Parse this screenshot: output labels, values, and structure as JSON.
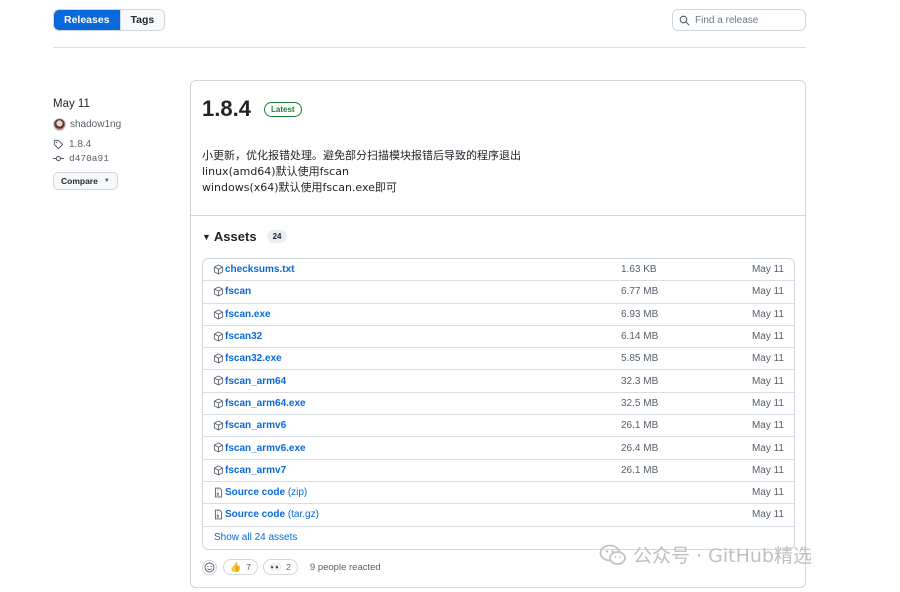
{
  "tabs": {
    "releases": "Releases",
    "tags": "Tags"
  },
  "search": {
    "placeholder": "Find a release"
  },
  "meta": {
    "date": "May 11",
    "author": "shadow1ng",
    "tag": "1.8.4",
    "commit": "d470a91",
    "compare_label": "Compare"
  },
  "release": {
    "version": "1.8.4",
    "badge": "Latest",
    "notes": [
      "小更新，优化报错处理。避免部分扫描模块报错后导致的程序退出",
      "linux(amd64)默认使用fscan",
      "windows(x64)默认使用fscan.exe即可"
    ]
  },
  "assets": {
    "title": "Assets",
    "count": "24",
    "items": [
      {
        "name": "checksums.txt",
        "ext": "",
        "size": "1.63 KB",
        "date": "May 11",
        "icon": "package-icon"
      },
      {
        "name": "fscan",
        "ext": "",
        "size": "6.77 MB",
        "date": "May 11",
        "icon": "package-icon"
      },
      {
        "name": "fscan.exe",
        "ext": "",
        "size": "6.93 MB",
        "date": "May 11",
        "icon": "package-icon"
      },
      {
        "name": "fscan32",
        "ext": "",
        "size": "6.14 MB",
        "date": "May 11",
        "icon": "package-icon"
      },
      {
        "name": "fscan32.exe",
        "ext": "",
        "size": "5.85 MB",
        "date": "May 11",
        "icon": "package-icon"
      },
      {
        "name": "fscan_arm64",
        "ext": "",
        "size": "32.3 MB",
        "date": "May 11",
        "icon": "package-icon"
      },
      {
        "name": "fscan_arm64.exe",
        "ext": "",
        "size": "32.5 MB",
        "date": "May 11",
        "icon": "package-icon"
      },
      {
        "name": "fscan_armv6",
        "ext": "",
        "size": "26.1 MB",
        "date": "May 11",
        "icon": "package-icon"
      },
      {
        "name": "fscan_armv6.exe",
        "ext": "",
        "size": "26.4 MB",
        "date": "May 11",
        "icon": "package-icon"
      },
      {
        "name": "fscan_armv7",
        "ext": "",
        "size": "26.1 MB",
        "date": "May 11",
        "icon": "package-icon"
      },
      {
        "name": "Source code",
        "ext": "(zip)",
        "size": "",
        "date": "May 11",
        "icon": "file-zip-icon"
      },
      {
        "name": "Source code",
        "ext": "(tar.gz)",
        "size": "",
        "date": "May 11",
        "icon": "file-zip-icon"
      }
    ],
    "show_all": "Show all 24 assets"
  },
  "reactions": {
    "thumbs_up": {
      "emoji": "👍",
      "count": "7"
    },
    "eyes": {
      "emoji": "👀",
      "count": "2"
    },
    "summary": "9 people reacted"
  },
  "watermark": {
    "text": "公众号 · GitHub精选"
  },
  "colors": {
    "accent": "#0969da",
    "latest": "#1a7f37",
    "border": "#d0d7de",
    "muted": "#57606a"
  }
}
